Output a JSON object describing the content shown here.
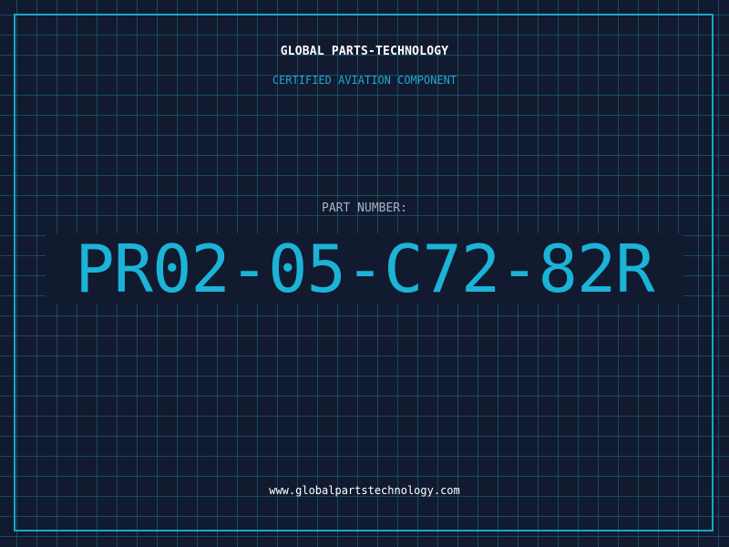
{
  "header": {
    "company": "GLOBAL PARTS-TECHNOLOGY",
    "subtitle": "CERTIFIED AVIATION COMPONENT"
  },
  "part": {
    "label": "PART NUMBER:",
    "number": "PR02-05-C72-82R"
  },
  "footer": {
    "url": "www.globalpartstechnology.com"
  },
  "colors": {
    "background": "#111a2e",
    "grid": "#206e8c",
    "accent": "#1cb3d8",
    "border": "#1aa6c8",
    "label": "#a6b4c4",
    "text": "#ffffff"
  }
}
